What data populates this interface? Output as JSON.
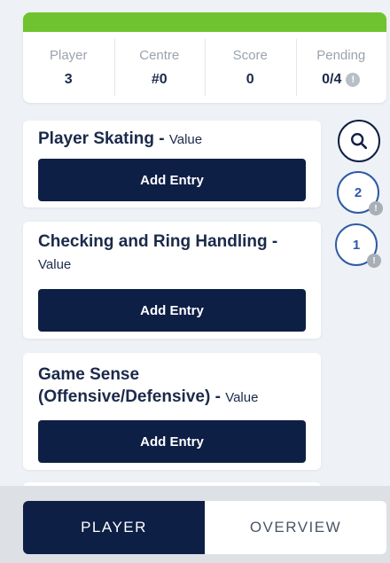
{
  "stats": [
    {
      "label": "Player",
      "value": "3"
    },
    {
      "label": "Centre",
      "value": "#0"
    },
    {
      "label": "Score",
      "value": "0"
    },
    {
      "label": "Pending",
      "value": "0/4"
    }
  ],
  "cards": [
    {
      "title": "Player Skating",
      "separator": " - ",
      "value_label": "Value",
      "button": "Add Entry"
    },
    {
      "title": "Checking and Ring Handling",
      "separator": " - ",
      "value_label": "Value",
      "button": "Add Entry"
    },
    {
      "title": "Game Sense (Offensive/Defensive)",
      "separator": " - ",
      "value_label": "Value",
      "button": "Add Entry"
    }
  ],
  "side": {
    "search_icon": "search-icon",
    "counters": [
      {
        "value": "2",
        "badge": "!"
      },
      {
        "value": "1",
        "badge": "!"
      }
    ],
    "pending_badge": "!"
  },
  "tabs": [
    {
      "label": "PLAYER",
      "active": true
    },
    {
      "label": "OVERVIEW",
      "active": false
    }
  ],
  "colors": {
    "accent_green": "#6fc330",
    "navy": "#0e1f45",
    "counter_blue": "#2e5aa6"
  }
}
